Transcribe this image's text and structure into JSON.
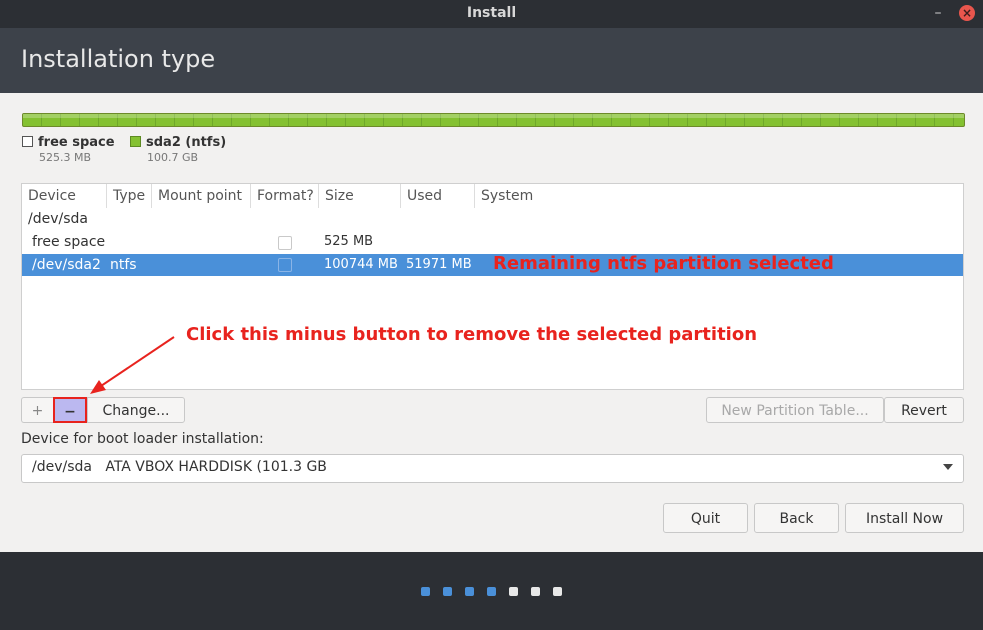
{
  "window": {
    "title": "Install",
    "minimize": "–",
    "close": "×"
  },
  "header": {
    "title": "Installation type"
  },
  "partition_bar": {
    "legend": [
      {
        "name": "free space",
        "size": "525.3 MB"
      },
      {
        "name": "sda2 (ntfs)",
        "size": "100.7 GB",
        "color": "#84c131"
      }
    ]
  },
  "table": {
    "columns": [
      "Device",
      "Type",
      "Mount point",
      "Format?",
      "Size",
      "Used",
      "System"
    ],
    "rows": [
      {
        "device": "/dev/sda",
        "type": "",
        "mount": "",
        "size": "",
        "used": ""
      },
      {
        "device": "free space",
        "type": "",
        "mount": "",
        "size": "525 MB",
        "used": ""
      },
      {
        "device": "/dev/sda2",
        "type": "ntfs",
        "mount": "",
        "size": "100744 MB",
        "used": "51971 MB",
        "selected": true
      }
    ]
  },
  "annotations": {
    "selected_note": "Remaining ntfs partition selected",
    "minus_note": "Click this minus button to remove the selected partition",
    "color": "#e8231e"
  },
  "buttons": {
    "add": "+",
    "remove": "−",
    "change": "Change...",
    "new_table": "New Partition Table...",
    "revert": "Revert",
    "quit": "Quit",
    "back": "Back",
    "install": "Install Now"
  },
  "bootloader": {
    "label": "Device for boot loader installation:",
    "value": "/dev/sda   ATA VBOX HARDDISK (101.3 GB"
  },
  "progress": {
    "total_steps": 7,
    "current_step": 4,
    "active_color": "#4a90d9",
    "inactive_color": "#e8e8e8"
  }
}
